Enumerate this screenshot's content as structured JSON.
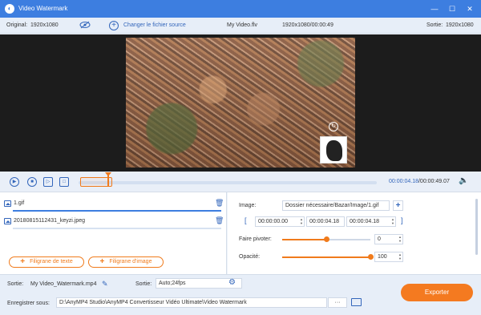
{
  "window": {
    "title": "Video Watermark",
    "controls": [
      "—",
      "☐",
      "✕"
    ]
  },
  "info": {
    "original_label": "Original:",
    "original_res": "1920x1080",
    "change_source": "Changer le fichier source",
    "filename": "My Video.flv",
    "meta": "1920x1080/00:00:49",
    "output_label": "Sortie:",
    "output_res": "1920x1080"
  },
  "transport": {
    "current_time": "00:00:04.18",
    "total_time": "/00:00:49.07",
    "progress_fraction": 0.1
  },
  "watermarks": [
    {
      "name": "1.gif",
      "selected": true
    },
    {
      "name": "20180815112431_keyzi.jpeg",
      "selected": false
    }
  ],
  "buttons": {
    "text_watermark": "Filigrane de texte",
    "image_watermark": "Filigrane d'image",
    "export": "Exporter"
  },
  "settings": {
    "image_label": "Image:",
    "image_path": "Dossier nécessaire/Bazar/Image/1.gif",
    "start_time": "00:00:00.00",
    "mid_time": "00:00:04.18",
    "end_time": "00:00:04.18",
    "rotate_label": "Faire pivoter:",
    "rotate_value": "0",
    "rotate_fraction": 0.5,
    "opacity_label": "Opacité:",
    "opacity_value": "100",
    "opacity_fraction": 1.0
  },
  "output": {
    "label": "Sortie:",
    "filename": "My Video_Watermark.mp4",
    "format_label": "Sortie:",
    "format_value": "Auto;24fps",
    "save_label": "Enregistrer sous:",
    "save_path": "D:\\AnyMP4 Studio\\AnyMP4 Convertisseur Vidéo Ultimate\\Video Watermark",
    "browse": "···"
  },
  "colors": {
    "accent": "#3d7ee0",
    "orange": "#f47a20"
  }
}
